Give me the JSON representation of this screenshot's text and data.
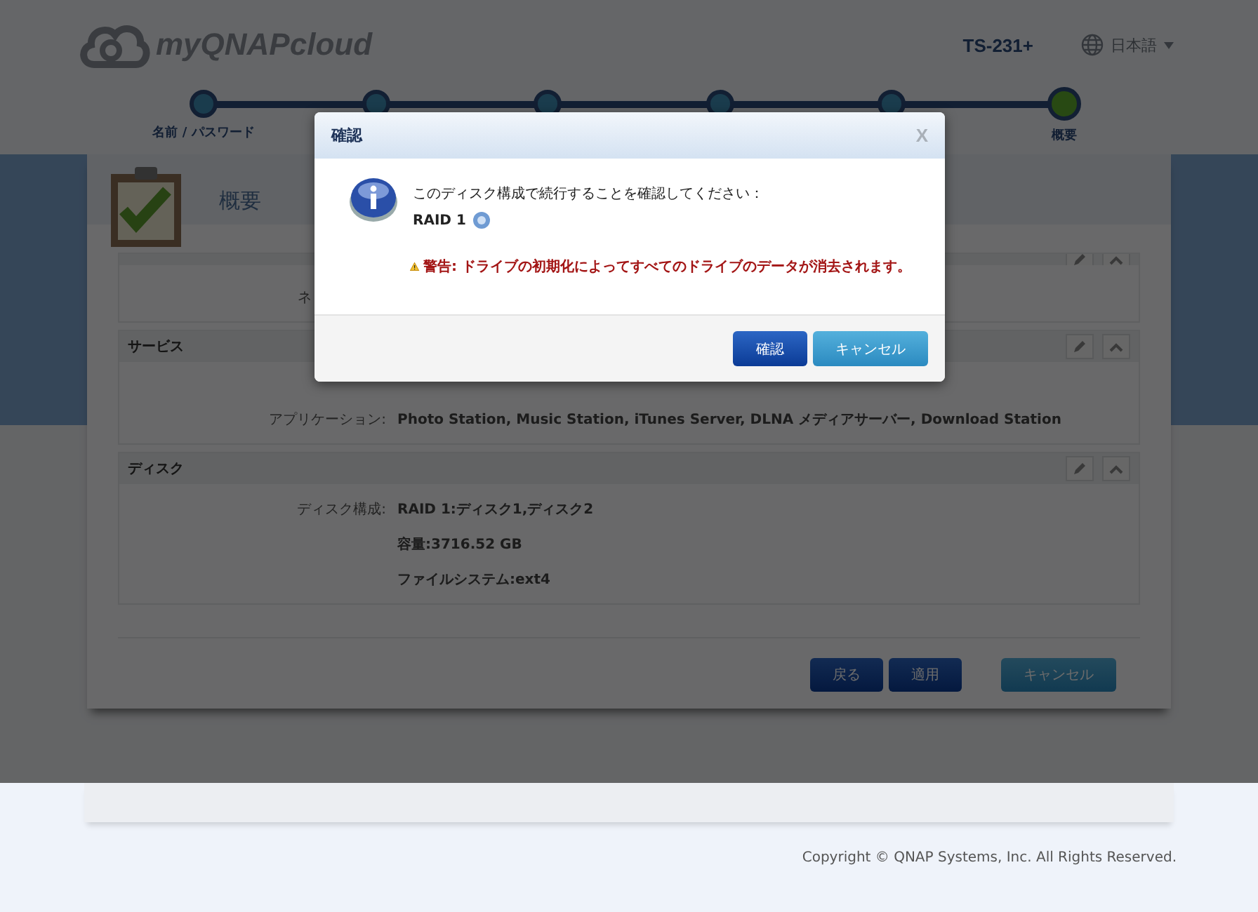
{
  "header": {
    "logo": "myQNAPcloud",
    "device": "TS-231+",
    "language": "日本語"
  },
  "steps": [
    {
      "label": "名前 / パスワード",
      "selected": false
    },
    {
      "selected": false
    },
    {
      "selected": false
    },
    {
      "selected": false
    },
    {
      "selected": false
    },
    {
      "label": "概要",
      "selected": true
    }
  ],
  "panel": {
    "title": "概要",
    "sections": [
      {
        "rows": [
          {
            "label": "ネ",
            "values": []
          }
        ]
      },
      {
        "title": "サービス",
        "rows": [
          {
            "values": []
          },
          {
            "label": "アプリケーション:",
            "values": [
              "Photo Station, Music Station, iTunes Server, DLNA メディアサーバー, Download Station"
            ]
          }
        ]
      },
      {
        "title": "ディスク",
        "rows": [
          {
            "label": "ディスク構成:",
            "values": [
              "RAID 1:ディスク1,ディスク2",
              "容量:3716.52 GB",
              "ファイルシステム:ext4"
            ]
          }
        ]
      }
    ],
    "buttons": [
      {
        "label": "戻る",
        "kind": "primary"
      },
      {
        "label": "適用",
        "kind": "primary"
      },
      {
        "label": "キャンセル",
        "kind": "secondary"
      }
    ]
  },
  "dialog": {
    "title": "確認",
    "close": "X",
    "message": "このディスク構成で続行することを確認してください：",
    "raid": "RAID 1",
    "warning": "警告: ドライブの初期化によってすべてのドライブのデータが消去されます。",
    "buttons": [
      {
        "label": "確認",
        "kind": "primary"
      },
      {
        "label": "キャンセル",
        "kind": "secondary"
      }
    ]
  },
  "footer": {
    "copyright": "Copyright © QNAP Systems, Inc. All Rights Reserved."
  }
}
